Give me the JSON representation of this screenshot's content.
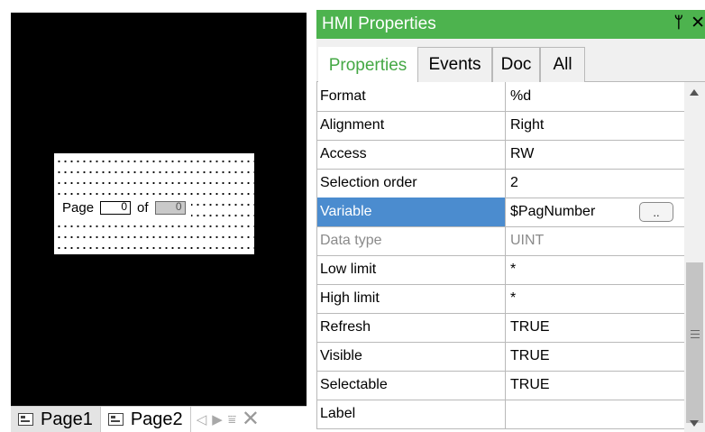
{
  "editor": {
    "widget": {
      "page_label": "Page",
      "of_label": "of",
      "current_value": "0",
      "total_value": "0"
    },
    "page_tabs": [
      {
        "label": "Page1",
        "active": true
      },
      {
        "label": "Page2",
        "active": false
      }
    ],
    "nav": {
      "prev": "◁",
      "next": "▶",
      "menu": "⩸",
      "close": "✕"
    }
  },
  "panel": {
    "title": "HMI Properties",
    "pin_icon": "pin-icon",
    "close_icon": "close-icon",
    "pin_glyph": "𝟰",
    "close_glyph": "✕",
    "tabs": [
      {
        "label": "Properties",
        "active": true
      },
      {
        "label": "Events",
        "active": false
      },
      {
        "label": "Doc",
        "active": false
      },
      {
        "label": "All",
        "active": false
      }
    ],
    "rows": [
      {
        "name": "Format",
        "value": "%d"
      },
      {
        "name": "Alignment",
        "value": "Right"
      },
      {
        "name": "Access",
        "value": "RW"
      },
      {
        "name": "Selection order",
        "value": "2"
      },
      {
        "name": "Variable",
        "value": "$PagNumber",
        "selected": true,
        "button": ".."
      },
      {
        "name": "Data type",
        "value": "UINT",
        "disabled": true
      },
      {
        "name": "Low limit",
        "value": "*"
      },
      {
        "name": "High limit",
        "value": "*"
      },
      {
        "name": "Refresh",
        "value": "TRUE"
      },
      {
        "name": "Visible",
        "value": "TRUE"
      },
      {
        "name": "Selectable",
        "value": "TRUE"
      },
      {
        "name": "Label",
        "value": ""
      }
    ],
    "colors": {
      "accent": "#4db34e",
      "selection": "#4b8ccf"
    }
  }
}
